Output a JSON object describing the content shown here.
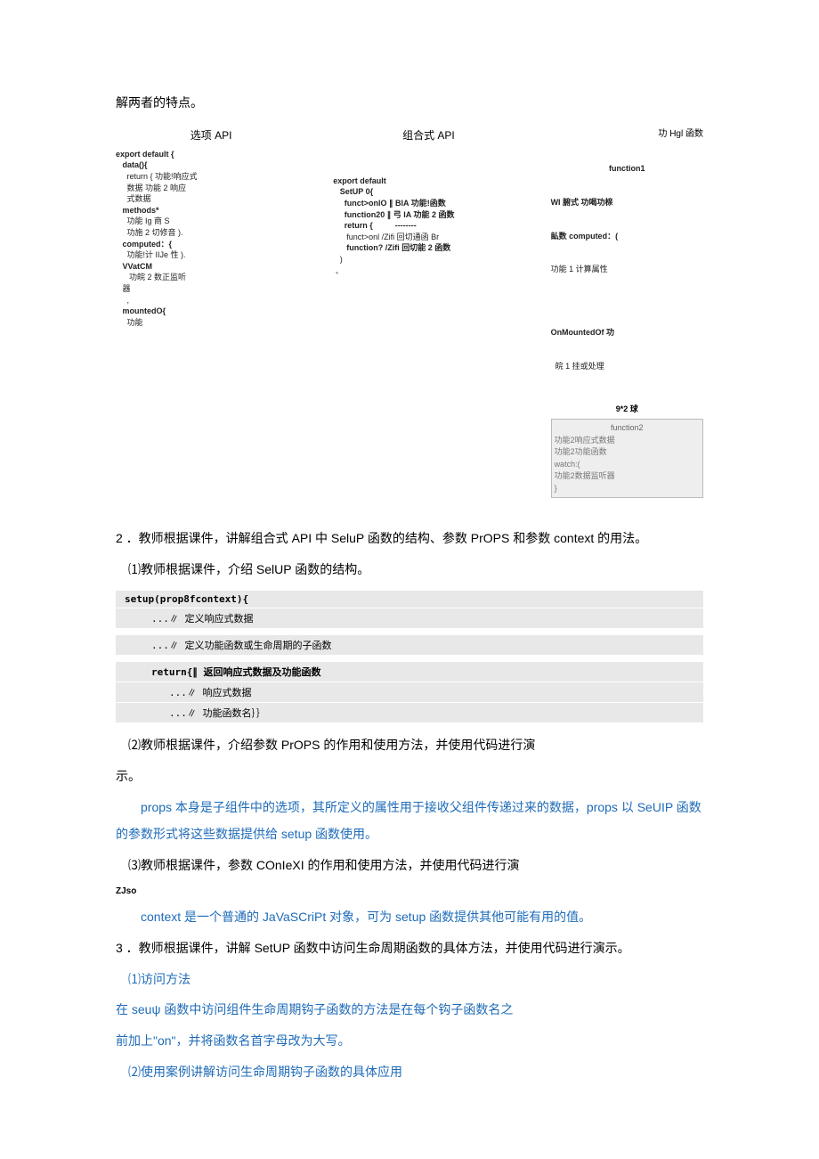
{
  "intro": "解两者的特点。",
  "diagram": {
    "left_title": "选项 API",
    "mid_title": "组合式 API",
    "right_title": "功 Hgl 函数",
    "left_code": [
      {
        "t": "export default {",
        "b": true
      },
      {
        "t": "   data(){",
        "b": true
      },
      {
        "t": "     return { 功能!响应式"
      },
      {
        "t": "     数据 功能 2 响应"
      },
      {
        "t": "     式数据"
      },
      {
        "t": ""
      },
      {
        "t": "   methods*",
        "b": true
      },
      {
        "t": "     功能 Ig 商 S"
      },
      {
        "t": "     功施 2 切修音 )."
      },
      {
        "t": "   computed：{",
        "b": true
      },
      {
        "t": "     功能!计 IIJe 性 )."
      },
      {
        "t": "   VVatCM",
        "b": true
      },
      {
        "t": "      功皖 2 数正监听"
      },
      {
        "t": "   器"
      },
      {
        "t": "     ,"
      },
      {
        "t": "   mountedO{",
        "b": true
      },
      {
        "t": "     功能"
      }
    ],
    "mid_code": [
      {
        "t": "export default",
        "b": true
      },
      {
        "t": "   SetUP 0{",
        "b": true
      },
      {
        "t": ""
      },
      {
        "t": "     funct>onlO ∥ BlA 功能!函数",
        "b": true
      },
      {
        "t": ""
      },
      {
        "t": "     function20 ∥ 弓 IA 功能 2 函数",
        "b": true
      },
      {
        "t": ""
      },
      {
        "t": "     return {          --------",
        "b": true
      },
      {
        "t": "      funct>onl /Zifi 回切通函 Br"
      },
      {
        "t": "      function? /Zifi 回切能 2 函数",
        "b": true
      },
      {
        "t": "   )"
      },
      {
        "t": " 、"
      }
    ],
    "right1": {
      "h": "function1",
      "b1": "WI 腑式 功喝功榇",
      "b2": "畆数 computed：(",
      "b3": "功能 1 计算属性",
      "b4": "OnMountedOf 功",
      "b5": "  皖 1 挂或处理"
    },
    "right2": {
      "h": "9*2 球",
      "fn": "function2",
      "l1": "功能2响应式数据",
      "l2": "功能2功能函数",
      "l3": "watch:(",
      "l4": "  功能2数据监听器",
      "l5": "}"
    }
  },
  "p2": "2 ．教师根据课件，讲解组合式 API 中 SeluP 函数的结构、参数 PrOPS 和参数 context 的用法。",
  "p2_1": "⑴教师根据课件，介绍 SelUP 函数的结构。",
  "code1": {
    "r1": "setup(prop8fcontext){",
    "r2": "...∥ 定义响应式数据",
    "r3": "...∥ 定义功能函数或生命周期的子函数",
    "r4": "return{∥ 返回响应式数据及功能函数",
    "r5": "...∥ 响应式数据",
    "r6": "...∥ 功能函数名｝｝"
  },
  "p2_2a": "⑵教师根据课件，介绍参数 PrOPS 的作用和使用方法，并使用代码进行演",
  "p2_2b": "示。",
  "p2_2c": "props 本身是子组件中的选项，其所定义的属性用于接收父组件传递过来的数据，props 以 SeUIP 函数的参数形式将这些数据提供给 setup 函数使用。",
  "p2_3a": "⑶教师根据课件，参数 COnIeXI 的作用和使用方法，并使用代码进行演",
  "zjso": "ZJso",
  "p2_3b": "context 是一个普通的 JaVaSCriPt 对象，可为 setup 函数提供其他可能有用的值。",
  "p3": "3 ．教师根据课件，讲解 SetUP 函数中访问生命周期函数的具体方法，并使用代码进行演示。",
  "p3_1": "⑴访问方法",
  "p3_1b": "在 seuψ 函数中访问组件生命周期钩子函数的方法是在每个钩子函数名之",
  "p3_1c": "前加上\"on\"，并将函数名首字母改为大写。",
  "p3_2": "⑵使用案例讲解访问生命周期钩子函数的具体应用"
}
